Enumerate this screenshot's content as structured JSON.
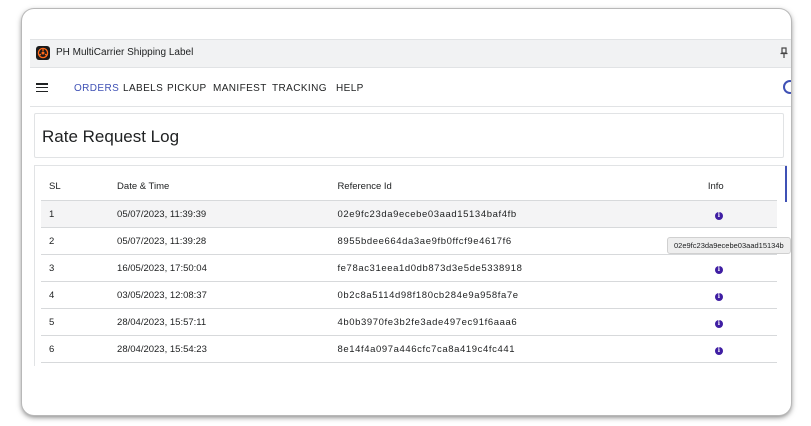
{
  "app": {
    "title": "PH MultiCarrier Shipping Label",
    "icon": "app-logo-icon",
    "pin_icon": "pin-icon"
  },
  "nav": {
    "menu_icon": "hamburger-menu-icon",
    "items": [
      {
        "label": "ORDERS",
        "active": true
      },
      {
        "label": "LABELS",
        "active": false
      },
      {
        "label": "PICKUP",
        "active": false
      },
      {
        "label": "MANIFEST",
        "active": false
      },
      {
        "label": "TRACKING",
        "active": false
      },
      {
        "label": "HELP",
        "active": false
      }
    ],
    "accent_color": "#3f51b5"
  },
  "page": {
    "title": "Rate Request Log"
  },
  "table": {
    "headers": {
      "sl": "SL",
      "datetime": "Date & Time",
      "reference": "Reference Id",
      "info": "Info"
    },
    "rows": [
      {
        "sl": "1",
        "datetime": "05/07/2023, 11:39:39",
        "reference": "02e9fc23da9ecebe03aad15134baf4fb",
        "info_icon": "info-icon"
      },
      {
        "sl": "2",
        "datetime": "05/07/2023, 11:39:28",
        "reference": "8955bdee664da3ae9fb0ffcf9e4617f6",
        "info_icon": "info-icon"
      },
      {
        "sl": "3",
        "datetime": "16/05/2023, 17:50:04",
        "reference": "fe78ac31eea1d0db873d3e5de5338918",
        "info_icon": "info-icon"
      },
      {
        "sl": "4",
        "datetime": "03/05/2023, 12:08:37",
        "reference": "0b2c8a5114d98f180cb284e9a958fa7e",
        "info_icon": "info-icon"
      },
      {
        "sl": "5",
        "datetime": "28/04/2023, 15:57:11",
        "reference": "4b0b3970fe3b2fe3ade497ec91f6aaa6",
        "info_icon": "info-icon"
      },
      {
        "sl": "6",
        "datetime": "28/04/2023, 15:54:23",
        "reference": "8e14f4a097a446cfc7ca8a419c4fc441",
        "info_icon": "info-icon"
      }
    ],
    "info_color": "#3f1ea3"
  },
  "tooltip": {
    "text": "02e9fc23da9ecebe03aad15134b"
  }
}
